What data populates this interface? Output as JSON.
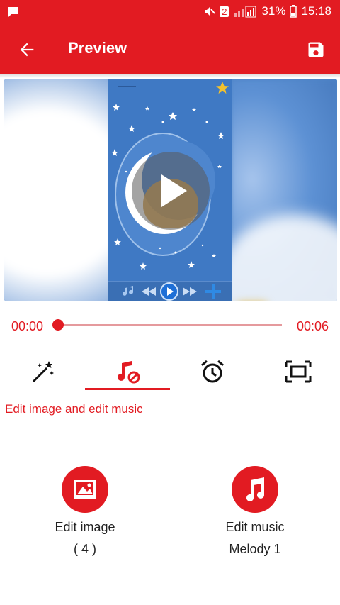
{
  "status_bar": {
    "notification_icon": "chat-bubble-icon",
    "signal_text": "2",
    "battery_percent": "31%",
    "time": "15:18"
  },
  "app_bar": {
    "title": "Preview",
    "back_icon": "arrow-back-icon",
    "save_icon": "save-icon"
  },
  "player": {
    "current_time": "00:00",
    "total_time": "00:06",
    "progress": 0
  },
  "tabs": [
    {
      "name": "magic-wand",
      "icon": "magic-wand-icon",
      "active": false
    },
    {
      "name": "music",
      "icon": "music-off-icon",
      "active": true
    },
    {
      "name": "alarm",
      "icon": "alarm-clock-icon",
      "active": false
    },
    {
      "name": "fullscreen",
      "icon": "aspect-ratio-icon",
      "active": false
    }
  ],
  "tab_caption": "Edit image and edit music",
  "actions": {
    "edit_image": {
      "label": "Edit image",
      "sub": "( 4 )",
      "icon": "image-icon"
    },
    "edit_music": {
      "label": "Edit music",
      "sub": "Melody 1",
      "icon": "music-note-icon"
    }
  },
  "colors": {
    "accent": "#e21b22",
    "track": "#e59a9d"
  }
}
